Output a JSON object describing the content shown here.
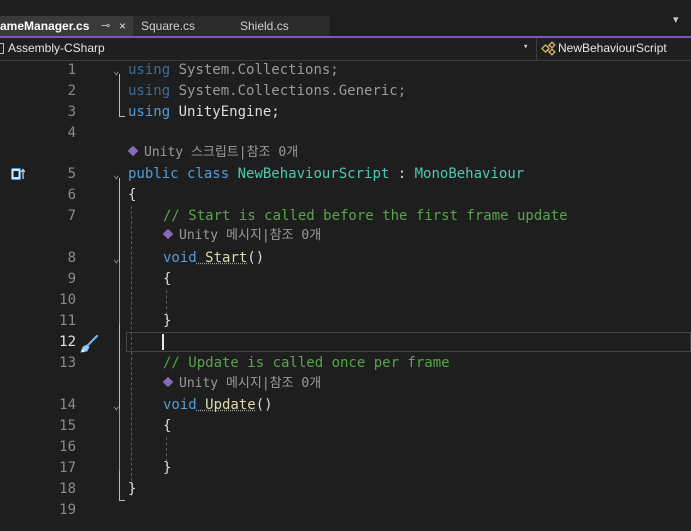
{
  "tabs": [
    {
      "label": "ameManager.cs",
      "active": true,
      "pin": "⊸",
      "close": "×"
    },
    {
      "label": "Square.cs",
      "active": false
    },
    {
      "label": "Shield.cs",
      "active": false
    }
  ],
  "tab_overflow": "▾",
  "navbar": {
    "project": "Assembly-CSharp",
    "type": "NewBehaviourScript",
    "dropdown": "▾"
  },
  "lines": [
    {
      "n": "1"
    },
    {
      "n": "2"
    },
    {
      "n": "3"
    },
    {
      "n": "4"
    },
    {
      "n": "5"
    },
    {
      "n": "6"
    },
    {
      "n": "7"
    },
    {
      "n": "8"
    },
    {
      "n": "9"
    },
    {
      "n": "10"
    },
    {
      "n": "11"
    },
    {
      "n": "12"
    },
    {
      "n": "13"
    },
    {
      "n": "14"
    },
    {
      "n": "15"
    },
    {
      "n": "16"
    },
    {
      "n": "17"
    },
    {
      "n": "18"
    },
    {
      "n": "19"
    }
  ],
  "code": {
    "l1": {
      "kw": "using",
      "ns": " System.Collections;"
    },
    "l2": {
      "kw": "using",
      "ns": " System.Collections.Generic;"
    },
    "l3": {
      "kw": "using",
      "ns": " UnityEngine;"
    },
    "lens_class": "Unity 스크립트|참조 0개",
    "l5": {
      "kw1": "public",
      "kw2": " class",
      "name": " NewBehaviourScript",
      "colon": " : ",
      "base": "MonoBehaviour"
    },
    "l6": "{",
    "l7": "// Start is called before the first frame update",
    "lens_start": "Unity 메시지|참조 0개",
    "l8": {
      "kw": "void",
      "name": " Start",
      "parens": "()"
    },
    "l9": "{",
    "l11": "}",
    "l13": "// Update is called once per frame",
    "lens_update": "Unity 메시지|참조 0개",
    "l14": {
      "kw": "void",
      "name": " Update",
      "parens": "()"
    },
    "l15": "{",
    "l17": "}",
    "l18": "}"
  },
  "fold_glyph": "⌄",
  "colors": {
    "accent": "#7a55c7",
    "keyword": "#569cd6",
    "class": "#4ec9b0",
    "comment": "#57a64a",
    "method": "#dcdcaa"
  }
}
